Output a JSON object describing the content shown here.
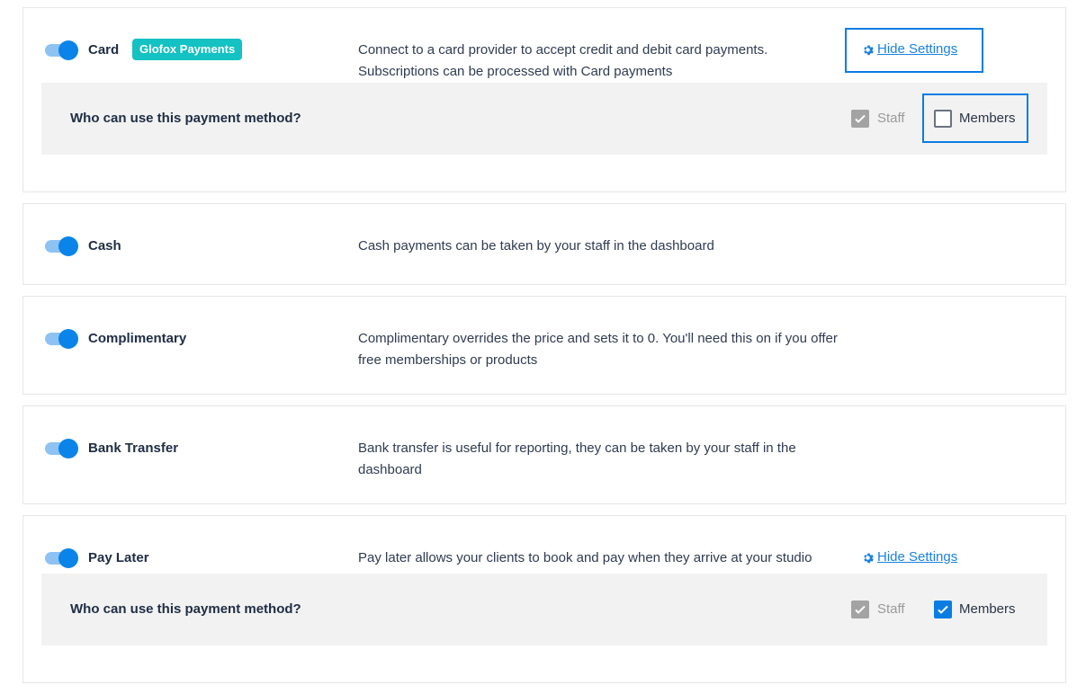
{
  "payment_methods": [
    {
      "name": "Card",
      "enabled": true,
      "badge": "Glofox Payments",
      "description": "Connect to a card provider to accept credit and debit card payments. Subscriptions can be processed with Card payments",
      "settings_link": "Hide Settings",
      "panel": {
        "question": "Who can use this payment method?",
        "staff_label": "Staff",
        "staff_checked": true,
        "members_label": "Members",
        "members_checked": false
      }
    },
    {
      "name": "Cash",
      "enabled": true,
      "description": "Cash payments can be taken by your staff in the dashboard"
    },
    {
      "name": "Complimentary",
      "enabled": true,
      "description": "Complimentary overrides the price and sets it to 0. You'll need this on if you offer free memberships or products"
    },
    {
      "name": "Bank Transfer",
      "enabled": true,
      "description": "Bank transfer is useful for reporting, they can be taken by your staff in the dashboard"
    },
    {
      "name": "Pay Later",
      "enabled": true,
      "description": "Pay later allows your clients to book and pay when they arrive at your studio",
      "settings_link": "Hide Settings",
      "panel": {
        "question": "Who can use this payment method?",
        "staff_label": "Staff",
        "staff_checked": true,
        "members_label": "Members",
        "members_checked": true
      }
    }
  ],
  "colors": {
    "accent": "#0a84e8",
    "badge": "#14c1c3",
    "panel_bg": "#f2f2f2",
    "highlight_border": "#0a7de3"
  },
  "icons": {
    "toggle": "toggle-on-icon",
    "settings": "gear-icon",
    "check": "checkmark-icon"
  }
}
